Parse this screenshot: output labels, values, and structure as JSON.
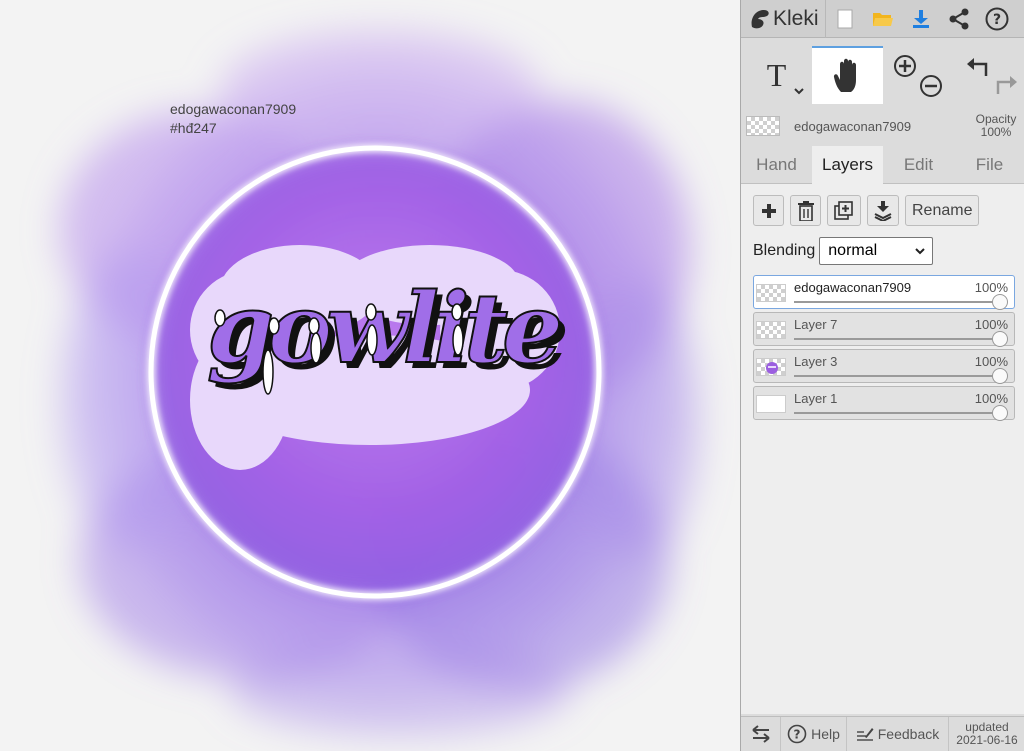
{
  "canvas": {
    "watermark_line1": "edogawaconan7909",
    "watermark_line2": "#hđ247",
    "artwork_word": "gowlite"
  },
  "app": {
    "logo_text": "Kleki",
    "top_icons": [
      "new-image-icon",
      "open-folder-icon",
      "download-icon",
      "share-icon",
      "help-icon"
    ]
  },
  "tools": {
    "text_tool_label": "T",
    "active": "hand"
  },
  "layer_info": {
    "name": "edogawaconan7909",
    "opacity_label": "Opacity",
    "opacity_value": "100%"
  },
  "tabs": [
    "Hand",
    "Layers",
    "Edit",
    "File"
  ],
  "active_tab": "Layers",
  "layers_panel": {
    "rename_label": "Rename",
    "blending_label": "Blending",
    "blending_value": "normal",
    "layers": [
      {
        "name": "edogawaconan7909",
        "opacity": "100%",
        "selected": true
      },
      {
        "name": "Layer 7",
        "opacity": "100%",
        "selected": false
      },
      {
        "name": "Layer 3",
        "opacity": "100%",
        "selected": false
      },
      {
        "name": "Layer 1",
        "opacity": "100%",
        "selected": false
      }
    ]
  },
  "bottom": {
    "help_label": "Help",
    "feedback_label": "Feedback",
    "updated_label": "updated",
    "updated_date": "2021-06-16"
  },
  "colors": {
    "accent": "#5ea0e0",
    "download": "#1f7fe0",
    "folder": "#f2b51e",
    "purple": "#9b5fe0"
  }
}
